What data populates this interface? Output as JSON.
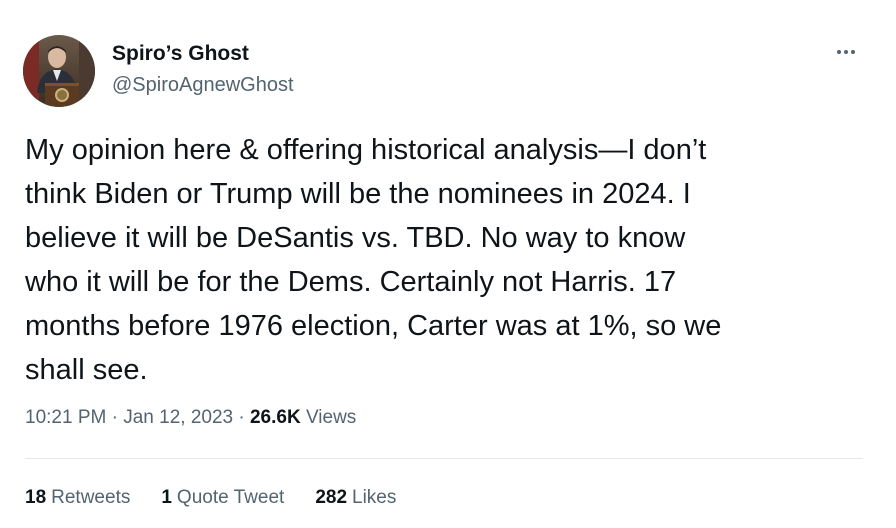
{
  "author": {
    "display_name": "Spiro’s Ghost",
    "handle": "@SpiroAgnewGhost"
  },
  "tweet": {
    "text_lines": [
      "My opinion here & offering historical analysis—I don’t",
      "think Biden or Trump will be the nominees in 2024. I",
      "believe it will be DeSantis vs. TBD. No way to know",
      "who it will be for the Dems. Certainly not Harris. 17",
      "months before 1976 election, Carter was at 1%, so we",
      "shall see."
    ]
  },
  "meta": {
    "time": "10:21 PM",
    "separator": "·",
    "date": "Jan 12, 2023",
    "views_count": "26.6K",
    "views_label": "Views"
  },
  "stats": {
    "retweets_count": "18",
    "retweets_label": "Retweets",
    "quotes_count": "1",
    "quotes_label": "Quote Tweet",
    "likes_count": "282",
    "likes_label": "Likes"
  },
  "icons": {
    "more": "more-horizontal-icon"
  },
  "colors": {
    "text_primary": "#0f1419",
    "text_secondary": "#536471",
    "divider": "#e6e9eb",
    "background": "#ffffff"
  }
}
